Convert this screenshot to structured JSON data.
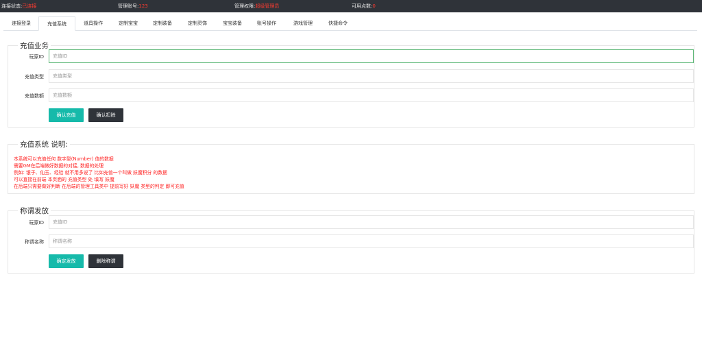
{
  "topbar": {
    "conn_label": "连接状态:",
    "conn_value": "已连接",
    "account_label": "管理账号:",
    "account_value": "123",
    "perm_label": "管理权限:",
    "perm_value": "超级管理员",
    "points_label": "可用点数:",
    "points_value": "0",
    "status_color": "#ff3b30"
  },
  "tabs": [
    "连接登录",
    "充值系统",
    "道具操作",
    "定制宝宝",
    "定制装备",
    "定制灵饰",
    "宝宝装备",
    "账号操作",
    "游戏管理",
    "快捷命令"
  ],
  "active_tab": "充值系统",
  "recharge": {
    "title": "充值业务",
    "player_label": "玩家ID",
    "player_placeholder": "充值ID",
    "type_label": "充值类型",
    "type_placeholder": "充值类型",
    "amount_label": "充值数额",
    "amount_placeholder": "充值数额",
    "confirm_button": "确认充值",
    "deduct_button": "确认扣除"
  },
  "notes": {
    "title": "充值系统 说明:",
    "lines": [
      "本系统可以充值任何 数字型(Number) 值的数据",
      "需要GM在后端做好数据的对接, 数据的处理",
      "例如: 银子、仙玉、经验 就不用多说了 比如充值一个叫做 妖魔积分 的数据",
      "可以直接在前端 本页面的 充值类型 处 填写 妖魔",
      "在后端只需要做好判断 在后端的管理工具类中 提前写好 妖魔 类型的判定 即可充值"
    ],
    "color": "#ff1f1f"
  },
  "title_grant": {
    "title": "称谓发放",
    "player_label": "玩家ID",
    "player_placeholder": "充值ID",
    "name_label": "称谓名称",
    "name_placeholder": "称谓名称",
    "grant_button": "确定发放",
    "delete_button": "删除称谓"
  },
  "colors": {
    "accent": "#16baaa",
    "dark": "#2f3339",
    "focus_border": "#5fb878"
  }
}
